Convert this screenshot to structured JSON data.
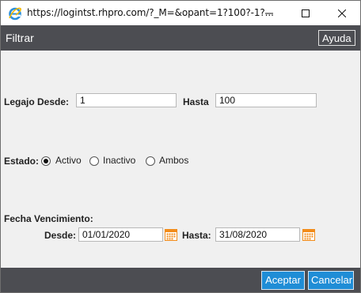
{
  "titlebar": {
    "url": "https://logintst.rhpro.com/?_M=&opant=1?100?-1?...",
    "icon": "ie-icon"
  },
  "header": {
    "title": "Filtrar",
    "help_label": "Ayuda"
  },
  "legajo": {
    "desde_label": "Legajo Desde:",
    "desde_value": "1",
    "hasta_label": "Hasta",
    "hasta_value": "100"
  },
  "estado": {
    "label": "Estado:",
    "options": [
      {
        "label": "Activo",
        "checked": true
      },
      {
        "label": "Inactivo",
        "checked": false
      },
      {
        "label": "Ambos",
        "checked": false
      }
    ]
  },
  "vencimiento": {
    "label": "Fecha Vencimiento:",
    "desde_label": "Desde:",
    "desde_value": "01/01/2020",
    "hasta_label": "Hasta:",
    "hasta_value": "31/08/2020"
  },
  "footer": {
    "accept_label": "Aceptar",
    "cancel_label": "Cancelar"
  },
  "colors": {
    "header_bg": "#4c4d52",
    "button_bg": "#1f8dd6",
    "calendar_icon": "#f28c1a"
  }
}
